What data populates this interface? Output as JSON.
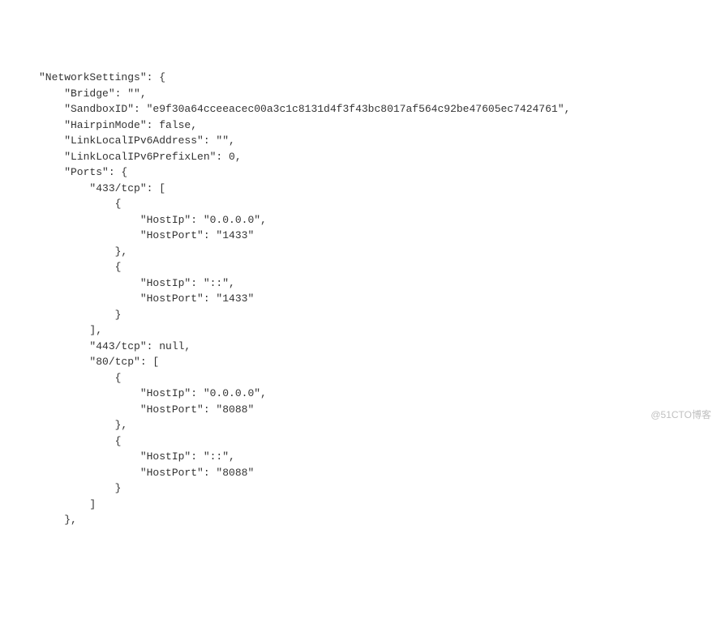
{
  "code_lines": [
    "\"NetworkSettings\": {",
    "    \"Bridge\": \"\",",
    "    \"SandboxID\": \"e9f30a64cceeacec00a3c1c8131d4f3f43bc8017af564c92be47605ec7424761\",",
    "    \"HairpinMode\": false,",
    "    \"LinkLocalIPv6Address\": \"\",",
    "    \"LinkLocalIPv6PrefixLen\": 0,",
    "    \"Ports\": {",
    "        \"433/tcp\": [",
    "            {",
    "                \"HostIp\": \"0.0.0.0\",",
    "                \"HostPort\": \"1433\"",
    "            },",
    "            {",
    "                \"HostIp\": \"::\",",
    "                \"HostPort\": \"1433\"",
    "            }",
    "        ],",
    "        \"443/tcp\": null,",
    "        \"80/tcp\": [",
    "            {",
    "                \"HostIp\": \"0.0.0.0\",",
    "                \"HostPort\": \"8088\"",
    "            },",
    "            {",
    "                \"HostIp\": \"::\",",
    "                \"HostPort\": \"8088\"",
    "            }",
    "        ]",
    "    },"
  ],
  "watermark": "@51CTO博客"
}
